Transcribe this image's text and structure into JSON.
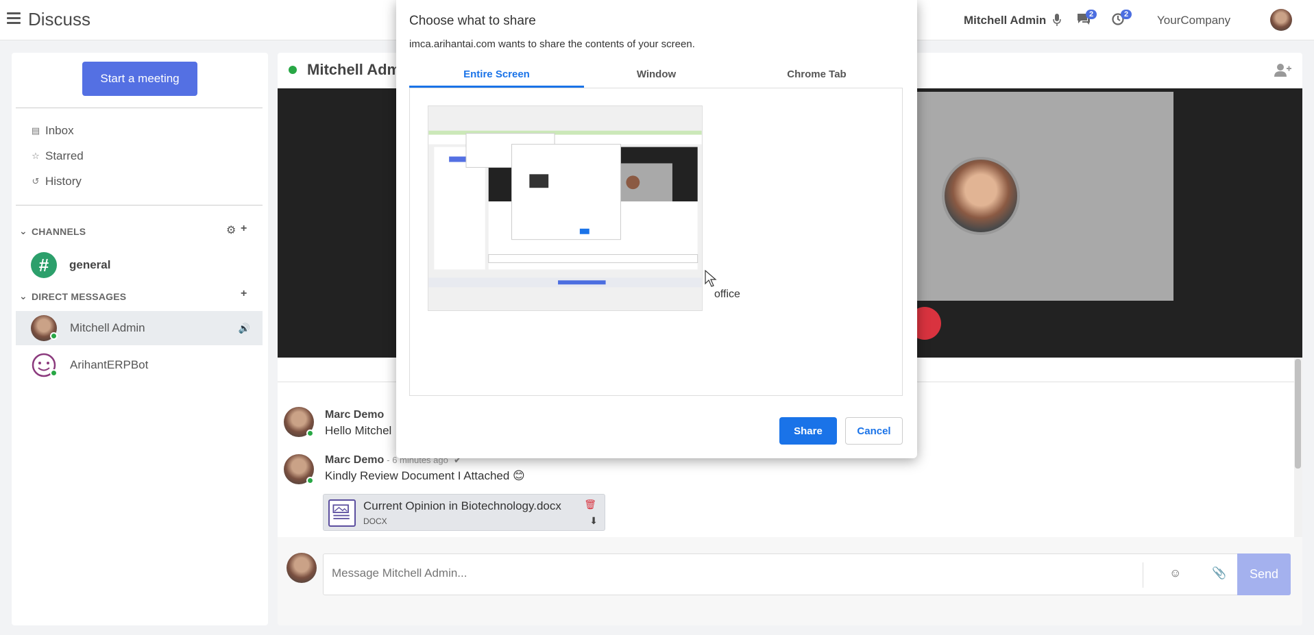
{
  "topbar": {
    "app_title": "Discuss",
    "user_name": "Mitchell Admin",
    "chat_badge": "2",
    "activity_badge": "2",
    "company": "YourCompany"
  },
  "sidebar": {
    "start_meeting": "Start a meeting",
    "nav": [
      {
        "label": "Inbox",
        "icon": "inbox-icon"
      },
      {
        "label": "Starred",
        "icon": "star-icon"
      },
      {
        "label": "History",
        "icon": "history-icon"
      }
    ],
    "channels_title": "CHANNELS",
    "channels": [
      {
        "name": "general"
      }
    ],
    "dm_title": "DIRECT MESSAGES",
    "direct_messages": [
      {
        "name": "Mitchell Admin",
        "active": true
      },
      {
        "name": "ArihantERPBot",
        "active": false
      }
    ]
  },
  "conversation": {
    "title": "Mitchell Adm",
    "messages": [
      {
        "author": "Marc Demo",
        "time": "",
        "text": "Hello Mitchel"
      },
      {
        "author": "Marc Demo",
        "time": "- 6 minutes ago",
        "text": "Kindly Review Document I Attached"
      }
    ],
    "attachment": {
      "name": "Current Opinion in Biotechnology.docx",
      "type": "DOCX"
    },
    "composer_placeholder": "Message Mitchell Admin...",
    "send_label": "Send"
  },
  "dialog": {
    "title": "Choose what to share",
    "subtitle": "imca.arihantai.com wants to share the contents of your screen.",
    "tabs": [
      "Entire Screen",
      "Window",
      "Chrome Tab"
    ],
    "screen_label": "office",
    "share_label": "Share",
    "cancel_label": "Cancel"
  },
  "colors": {
    "primary": "#5470e3",
    "online": "#28a745",
    "chrome_blue": "#1a73e8",
    "danger": "#d9333f"
  }
}
